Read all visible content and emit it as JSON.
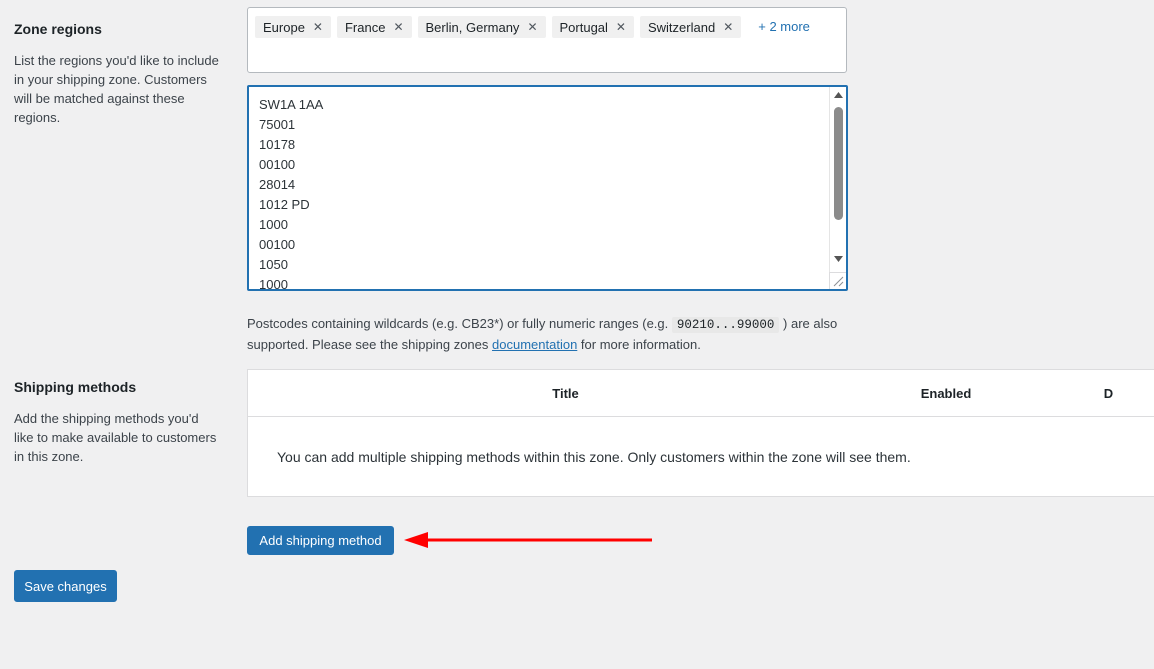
{
  "zone_regions": {
    "title": "Zone regions",
    "description": "List the regions you'd like to include in your shipping zone. Customers will be matched against these regions.",
    "chips": [
      {
        "label": "Europe",
        "remove": "✕"
      },
      {
        "label": "France",
        "remove": "✕"
      },
      {
        "label": "Berlin, Germany",
        "remove": "✕"
      },
      {
        "label": "Portugal",
        "remove": "✕"
      },
      {
        "label": "Switzerland",
        "remove": "✕"
      }
    ],
    "more_link": "+ 2 more"
  },
  "postcodes": {
    "value": "SW1A 1AA\n75001\n10178\n00100\n28014\n1012 PD\n1000\n00100\n1050\n1000",
    "lines": [
      "SW1A 1AA",
      "75001",
      "10178",
      "00100",
      "28014",
      "1012 PD",
      "1000",
      "00100",
      "1050",
      "1000"
    ],
    "help_before_code": "Postcodes containing wildcards (e.g. CB23*) or fully numeric ranges (e.g. ",
    "help_code": "90210...99000",
    "help_after_code": " ) are also supported. Please see the shipping zones ",
    "help_link": "documentation",
    "help_end": " for more information."
  },
  "shipping_methods": {
    "title": "Shipping methods",
    "description": "Add the shipping methods you'd like to make available to customers in this zone.",
    "columns": [
      "",
      "Title",
      "Enabled",
      "D"
    ],
    "empty_message": "You can add multiple shipping methods within this zone. Only customers within the zone will see them.",
    "add_button": "Add shipping method"
  },
  "actions": {
    "save_button": "Save changes"
  },
  "colors": {
    "primary": "#2271b1",
    "page_background": "#f0f0f1",
    "annotation_arrow": "#ff0000",
    "chip_background": "#f0f0f0"
  }
}
